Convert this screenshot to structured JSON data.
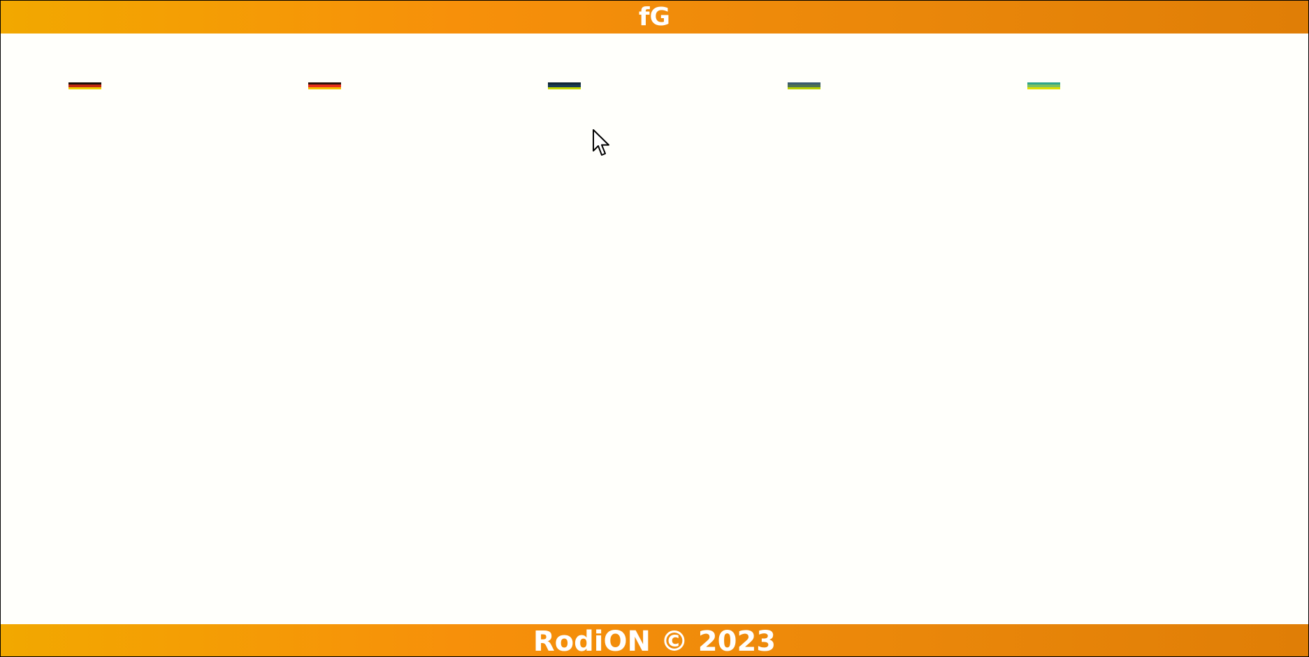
{
  "header": {
    "title": "fG"
  },
  "thumbnails": [
    {
      "name": "gallery-thumbnail-1",
      "colors": [
        "#1a0d06",
        "#c22a10",
        "#f0d000"
      ]
    },
    {
      "name": "gallery-thumbnail-2",
      "colors": [
        "#2b1008",
        "#e8301a",
        "#f5c000"
      ]
    },
    {
      "name": "gallery-thumbnail-3",
      "colors": [
        "#0f2536",
        "#1a3b50",
        "#c4d800"
      ]
    },
    {
      "name": "gallery-thumbnail-4",
      "colors": [
        "#3a5a6e",
        "#4f7250",
        "#b8d000"
      ]
    },
    {
      "name": "gallery-thumbnail-5",
      "colors": [
        "#2fa58a",
        "#7fc060",
        "#e0e000"
      ]
    }
  ],
  "footer": {
    "copyright": "RodiON © 2023"
  },
  "cursor": {
    "icon": "mouse-pointer-icon"
  }
}
